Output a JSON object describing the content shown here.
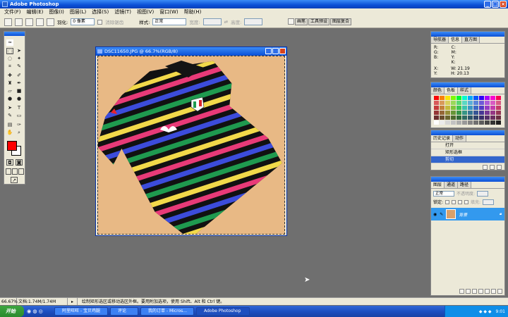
{
  "app": {
    "title": "Adobe Photoshop"
  },
  "menu": [
    "文件(F)",
    "编辑(E)",
    "图像(I)",
    "图层(L)",
    "选择(S)",
    "滤镜(T)",
    "视图(V)",
    "窗口(W)",
    "帮助(H)"
  ],
  "options": {
    "feather_label": "羽化:",
    "feather_value": "0 像素",
    "antialias_label": "消除锯齿",
    "style_label": "样式:",
    "style_value": "正常",
    "width_label": "宽度:",
    "height_label": "高度:",
    "palette_tabs": [
      "画笔",
      "工具预设",
      "图层复合"
    ]
  },
  "document": {
    "title": "DSC11650.JPG @ 66.7%(RGB/8)"
  },
  "info_panel": {
    "tabs": [
      "导航器",
      "信息",
      "直方图"
    ],
    "r": "R:",
    "g": "G:",
    "b": "B:",
    "c": "C:",
    "m": "M:",
    "y": "Y:",
    "k": "K:",
    "x": "X:",
    "yy": "Y:",
    "w": "W:",
    "w_val": "21.19",
    "h": "H:",
    "h_val": "20.13"
  },
  "swatch_panel": {
    "tabs": [
      "颜色",
      "色板",
      "样式"
    ]
  },
  "history_panel": {
    "tabs": [
      "历史记录",
      "动作"
    ],
    "items": [
      "打开",
      "矩形选框",
      "剪切"
    ]
  },
  "layers_panel": {
    "tabs": [
      "图层",
      "通道",
      "路径"
    ],
    "blend": "正常",
    "opacity_label": "不透明度:",
    "lock_label": "锁定:",
    "fill_label": "填充:",
    "layer_name": "背景"
  },
  "status": {
    "zoom": "66.67%",
    "doc": "文档:1.74M/1.74M",
    "hint": "绘制矩形选区或移动选区外框。要用附加选项，使用 Shift、Alt 和 Ctrl 键。"
  },
  "taskbar": {
    "start": "开始",
    "tasks": [
      "阿里旺旺 - 宝贝鸡腿",
      "评论",
      "我的订单 - Micros...",
      "Adobe Photoshop"
    ],
    "clock": "9:01"
  },
  "colors": {
    "foreground": "#ff0000",
    "background": "#ffffff",
    "accent": "#0a4fd6"
  }
}
